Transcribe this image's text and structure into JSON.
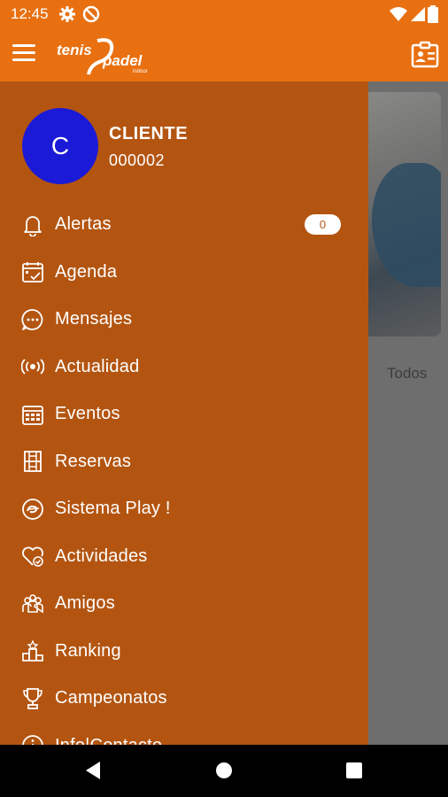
{
  "status": {
    "time": "12:45"
  },
  "header": {
    "logo_text_1": "tenis",
    "logo_text_2": "padel",
    "logo_text_3": "indoor"
  },
  "user": {
    "avatar_letter": "C",
    "name": "CLIENTE",
    "id": "000002"
  },
  "menu": [
    {
      "label": "Alertas",
      "icon": "bell-icon",
      "badge": "0"
    },
    {
      "label": "Agenda",
      "icon": "calendar-check-icon"
    },
    {
      "label": "Mensajes",
      "icon": "chat-bubble-icon"
    },
    {
      "label": "Actualidad",
      "icon": "broadcast-icon"
    },
    {
      "label": "Eventos",
      "icon": "calendar-grid-icon"
    },
    {
      "label": "Reservas",
      "icon": "court-icon"
    },
    {
      "label": "Sistema Play !",
      "icon": "play-badge-icon"
    },
    {
      "label": "Actividades",
      "icon": "heart-check-icon"
    },
    {
      "label": "Amigos",
      "icon": "friends-icon"
    },
    {
      "label": "Ranking",
      "icon": "podium-icon"
    },
    {
      "label": "Campeonatos",
      "icon": "trophy-icon"
    },
    {
      "label": "Info|Contacto",
      "icon": "info-icon"
    }
  ],
  "background": {
    "filter_label": "Todos"
  },
  "colors": {
    "appbar": "#e87011",
    "drawer": "#b35511",
    "avatar": "#1b1ad6"
  }
}
